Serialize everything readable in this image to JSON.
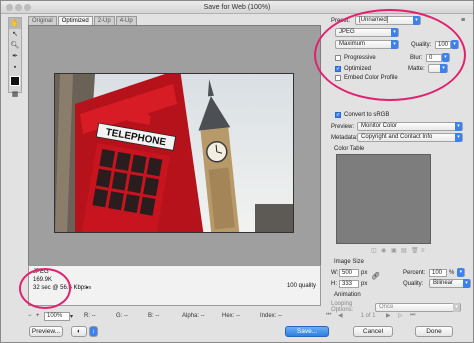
{
  "window": {
    "title": "Save for Web (100%)"
  },
  "tabs": [
    "Original",
    "Optimized",
    "2-Up",
    "4-Up"
  ],
  "tools": [
    "hand-tool",
    "slice-select-tool",
    "zoom-tool",
    "eyedropper-tool"
  ],
  "settings": {
    "preset_label": "Preset:",
    "preset_value": "[Unnamed]",
    "format_value": "JPEG",
    "quality_level": "Maximum",
    "quality_label": "Quality:",
    "quality_value": "100",
    "progressive_label": "Progressive",
    "blur_label": "Blur:",
    "blur_value": "0",
    "optimized_label": "Optimized",
    "matte_label": "Matte:",
    "embed_profile_label": "Embed Color Profile",
    "convert_srgb_label": "Convert to sRGB",
    "preview_label": "Preview:",
    "preview_value": "Monitor Color",
    "metadata_label": "Metadata:",
    "metadata_value": "Copyright and Contact Info",
    "color_table_label": "Color Table",
    "image_size_label": "Image Size",
    "width_label": "W:",
    "width_value": "500",
    "height_label": "H:",
    "height_value": "333",
    "px_unit": "px",
    "percent_label": "Percent:",
    "percent_value": "100",
    "percent_unit": "%",
    "quality2_label": "Quality:",
    "quality2_value": "Bilinear",
    "animation_label": "Animation",
    "looping_label": "Looping Options:",
    "looping_value": "Once",
    "frame_counter": "1 of 1"
  },
  "info": {
    "format": "JPEG",
    "size": "169.9K",
    "download": "32 sec @ 56.6 Kbps",
    "quality_note": "100 quality"
  },
  "bottom": {
    "zoom_value": "100%",
    "r_label": "R: --",
    "g_label": "G: --",
    "b_label": "B: --",
    "alpha_label": "Alpha: --",
    "hex_label": "Hex: --",
    "index_label": "Index: --"
  },
  "buttons": {
    "preview": "Preview...",
    "save": "Save...",
    "cancel": "Cancel",
    "done": "Done"
  },
  "photo": {
    "sign_text": "TELEPHONE"
  }
}
